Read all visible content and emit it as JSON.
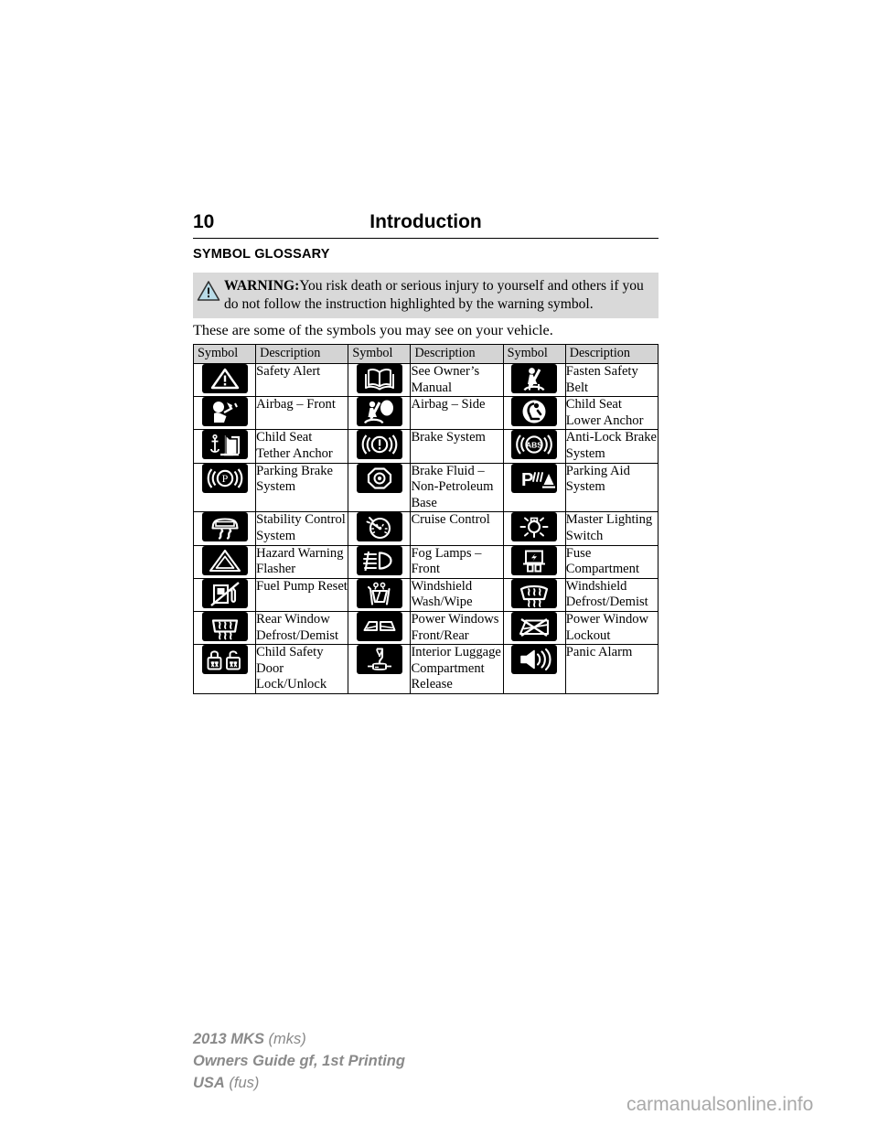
{
  "header": {
    "page_number": "10",
    "chapter": "Introduction"
  },
  "section_title": "SYMBOL GLOSSARY",
  "warning": {
    "icon": "warning-triangle-icon",
    "label": "WARNING:",
    "text": "You risk death or serious injury to yourself and others if you do not follow the instruction highlighted by the warning symbol.",
    "background_color": "#d9d9d9",
    "triangle_fill": "#b9dce8"
  },
  "intro_text": "These are some of the symbols you may see on your vehicle.",
  "table": {
    "headers": [
      "Symbol",
      "Description",
      "Symbol",
      "Description",
      "Symbol",
      "Description"
    ],
    "rows": [
      [
        {
          "icon": "safety-alert-icon",
          "label": "Safety Alert"
        },
        {
          "icon": "owners-manual-icon",
          "label": "See Owner’s Manual"
        },
        {
          "icon": "fasten-safety-belt-icon",
          "label": "Fasten Safety Belt"
        }
      ],
      [
        {
          "icon": "airbag-front-icon",
          "label": "Airbag – Front"
        },
        {
          "icon": "airbag-side-icon",
          "label": "Airbag – Side"
        },
        {
          "icon": "child-seat-lower-anchor-icon",
          "label": "Child Seat Lower Anchor"
        }
      ],
      [
        {
          "icon": "child-seat-tether-anchor-icon",
          "label": "Child Seat Tether Anchor"
        },
        {
          "icon": "brake-system-icon",
          "label": "Brake System"
        },
        {
          "icon": "anti-lock-brake-system-icon",
          "label": "Anti-Lock Brake System"
        }
      ],
      [
        {
          "icon": "parking-brake-system-icon",
          "label": "Parking Brake System"
        },
        {
          "icon": "brake-fluid-non-petroleum-icon",
          "label": "Brake Fluid – Non-Petroleum Base"
        },
        {
          "icon": "parking-aid-system-icon",
          "label": "Parking Aid System"
        }
      ],
      [
        {
          "icon": "stability-control-system-icon",
          "label": "Stability Control System"
        },
        {
          "icon": "cruise-control-icon",
          "label": "Cruise Control"
        },
        {
          "icon": "master-lighting-switch-icon",
          "label": "Master Lighting Switch"
        }
      ],
      [
        {
          "icon": "hazard-warning-flasher-icon",
          "label": "Hazard Warning Flasher"
        },
        {
          "icon": "fog-lamps-front-icon",
          "label": "Fog Lamps – Front"
        },
        {
          "icon": "fuse-compartment-icon",
          "label": "Fuse Compartment"
        }
      ],
      [
        {
          "icon": "fuel-pump-reset-icon",
          "label": "Fuel Pump Reset"
        },
        {
          "icon": "windshield-wash-wipe-icon",
          "label": "Windshield Wash/Wipe"
        },
        {
          "icon": "windshield-defrost-demist-icon",
          "label": "Windshield Defrost/Demist"
        }
      ],
      [
        {
          "icon": "rear-window-defrost-demist-icon",
          "label": "Rear Window Defrost/Demist"
        },
        {
          "icon": "power-windows-front-rear-icon",
          "label": "Power Windows Front/Rear"
        },
        {
          "icon": "power-window-lockout-icon",
          "label": "Power Window Lockout"
        }
      ],
      [
        {
          "icon": "child-safety-door-lock-unlock-icon",
          "label": "Child Safety Door Lock/Unlock"
        },
        {
          "icon": "interior-luggage-compartment-release-icon",
          "label": "Interior Luggage Compartment Release"
        },
        {
          "icon": "panic-alarm-icon",
          "label": "Panic Alarm"
        }
      ]
    ]
  },
  "footer": {
    "line1_bold": "2013 MKS",
    "line1_light": " (mks)",
    "line2": "Owners Guide gf, 1st Printing",
    "line3_bold": "USA",
    "line3_light": " (fus)",
    "color": "#8a8a8a"
  },
  "watermark": "carmanualsonline.info"
}
